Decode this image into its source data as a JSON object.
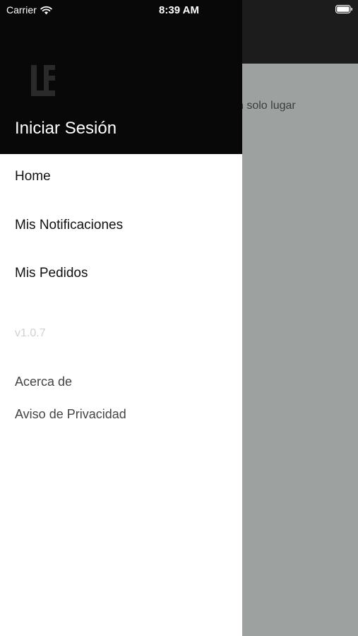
{
  "status_bar": {
    "carrier": "Carrier",
    "time": "8:39 AM",
    "wifi_icon": "wifi-icon",
    "battery_icon": "battery-icon"
  },
  "background": {
    "partial_text": "n solo lugar"
  },
  "drawer": {
    "header": {
      "logo_icon": "app-logo-icon",
      "login_label": "Iniciar Sesión"
    },
    "menu": [
      {
        "label": "Home"
      },
      {
        "label": "Mis Notificaciones"
      },
      {
        "label": "Mis Pedidos"
      }
    ],
    "version": "v1.0.7",
    "links": [
      {
        "label": "Acerca de"
      },
      {
        "label": "Aviso de Privacidad"
      }
    ]
  },
  "colors": {
    "header_bg": "#080808",
    "overlay_bg": "#9da1a0",
    "drawer_bg": "#ffffff"
  }
}
